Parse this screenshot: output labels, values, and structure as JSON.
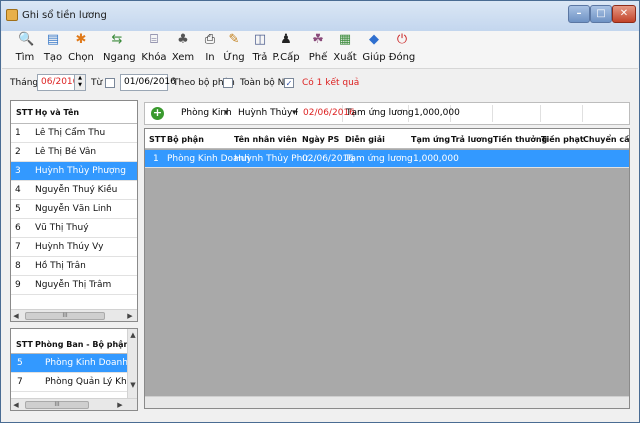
{
  "window": {
    "title": "Ghi sổ tiền lương"
  },
  "toolbar": {
    "buttons": [
      {
        "label": "Tìm",
        "icon": "🔍",
        "color": "#2f6fcf"
      },
      {
        "label": "Tạo",
        "icon": "▤",
        "color": "#3d7cc9"
      },
      {
        "label": "Chọn",
        "icon": "✱",
        "color": "#e07a1a"
      },
      {
        "label": "Ngang",
        "icon": "⇆",
        "color": "#3a8a3a"
      },
      {
        "label": "Khóa",
        "icon": "⌸",
        "color": "#3b3b6e"
      },
      {
        "label": "Xem",
        "icon": "♣",
        "color": "#555"
      },
      {
        "label": "In",
        "icon": "⎙",
        "color": "#222"
      },
      {
        "label": "Ứng",
        "icon": "✎",
        "color": "#c27f1a"
      },
      {
        "label": "Trả",
        "icon": "◫",
        "color": "#4f5f8f"
      },
      {
        "label": "P.Cấp",
        "icon": "♟",
        "color": "#222"
      },
      {
        "label": "Phế",
        "icon": "☘",
        "color": "#8a4a7a"
      },
      {
        "label": "Xuất",
        "icon": "▦",
        "color": "#3a8a3a"
      },
      {
        "label": "Giúp",
        "icon": "◆",
        "color": "#2f6fcf"
      },
      {
        "label": "Đóng",
        "icon": "⏻",
        "color": "#cc2a2a"
      }
    ]
  },
  "filter": {
    "month_label": "Tháng",
    "month_value": "06/2016",
    "from_label": "Từ",
    "from_date": "01/06/2016",
    "by_dept_label": "Theo bộ phận",
    "all_staff_label": "Toàn bộ NV",
    "all_staff_checked": "✓",
    "result_text": "Có 1 kết quả",
    "result_color": "#d22"
  },
  "staff_grid": {
    "headers": {
      "stt": "STT",
      "name": "Họ và Tên"
    },
    "rows": [
      {
        "stt": "1",
        "name": "Lê Thị Cẩm Thu"
      },
      {
        "stt": "2",
        "name": "Lê Thị Bé Vân"
      },
      {
        "stt": "3",
        "name": "Huỳnh Thủy Phượng"
      },
      {
        "stt": "4",
        "name": "Nguyễn Thuý Kiều"
      },
      {
        "stt": "5",
        "name": "Nguyễn Văn Linh"
      },
      {
        "stt": "6",
        "name": "Vũ Thị Thuý"
      },
      {
        "stt": "7",
        "name": "Huỳnh Thúy Vy"
      },
      {
        "stt": "8",
        "name": "Hồ Thị Trân"
      },
      {
        "stt": "9",
        "name": "Nguyễn Thị Trâm"
      }
    ],
    "selected_stt": "3"
  },
  "dept_grid": {
    "headers": {
      "stt": "STT",
      "name": "Phòng Ban - Bộ phận"
    },
    "rows": [
      {
        "stt": "5",
        "name": "Phòng Kinh Doanh"
      },
      {
        "stt": "7",
        "name": "Phòng Quản Lý Kho"
      }
    ],
    "selected_stt": "5"
  },
  "scroll_thumb": "III",
  "entry": {
    "dept": "Phòng Kinh",
    "staff": "Huỳnh Thủy Phi",
    "date": "02/06/2016",
    "description": "Tạm ứng lương",
    "amount": "1,000,000",
    "date_color": "#d22"
  },
  "ledger": {
    "headers": [
      "STT",
      "Bộ phận",
      "Tên nhân viên",
      "Ngày PS",
      "Diễn giải",
      "Tạm ứng",
      "Trả lương",
      "Tiền thưởng",
      "Tiền phạt",
      "Chuyển cần"
    ],
    "rows": [
      {
        "stt": "1",
        "dept": "Phòng Kinh Doanh",
        "staff": "Huỳnh Thủy Phư...",
        "date": "02/06/2016",
        "description": "Tạm ứng lương",
        "advance": "1,000,000"
      }
    ]
  }
}
